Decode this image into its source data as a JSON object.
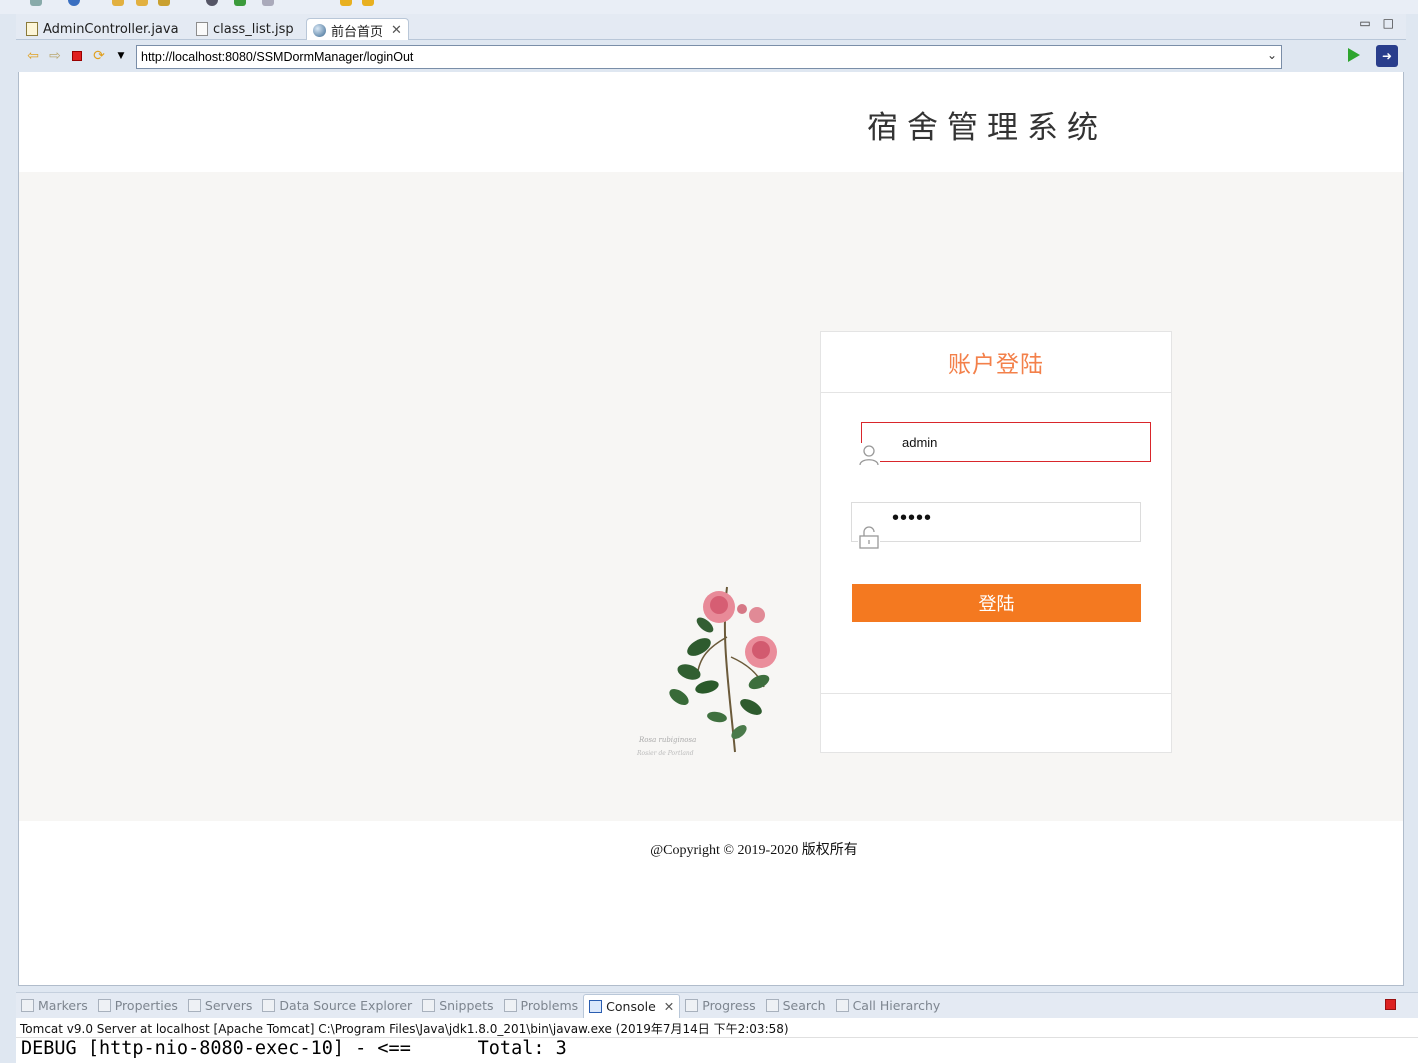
{
  "editor": {
    "tabs": [
      {
        "label": "AdminController.java",
        "icon": "java-file-icon"
      },
      {
        "label": "class_list.jsp",
        "icon": "jsp-file-icon"
      },
      {
        "label": "前台首页",
        "icon": "browser-globe-icon",
        "active": true
      }
    ]
  },
  "browser": {
    "url": "http://localhost:8080/SSMDormManager/loginOut"
  },
  "page": {
    "site_title": "宿舍管理系统",
    "login": {
      "title": "账户登陆",
      "username_value": "admin",
      "password_masked": "•••••",
      "submit_label": "登陆"
    },
    "copyright": "@Copyright © 2019-2020 版权所有"
  },
  "views": {
    "tabs": [
      {
        "label": "Markers"
      },
      {
        "label": "Properties"
      },
      {
        "label": "Servers"
      },
      {
        "label": "Data Source Explorer"
      },
      {
        "label": "Snippets"
      },
      {
        "label": "Problems"
      },
      {
        "label": "Console",
        "active": true
      },
      {
        "label": "Progress"
      },
      {
        "label": "Search"
      },
      {
        "label": "Call Hierarchy"
      }
    ],
    "console_info": "Tomcat v9.0 Server at localhost [Apache Tomcat] C:\\Program Files\\Java\\jdk1.8.0_201\\bin\\javaw.exe (2019年7月14日 下午2:03:58)",
    "console_line": "DEBUG [http-nio-8080-exec-10] - <==      Total: 3"
  },
  "colors": {
    "accent": "#f47920",
    "login_title": "#f3804a",
    "focused_border": "#d9262b"
  }
}
